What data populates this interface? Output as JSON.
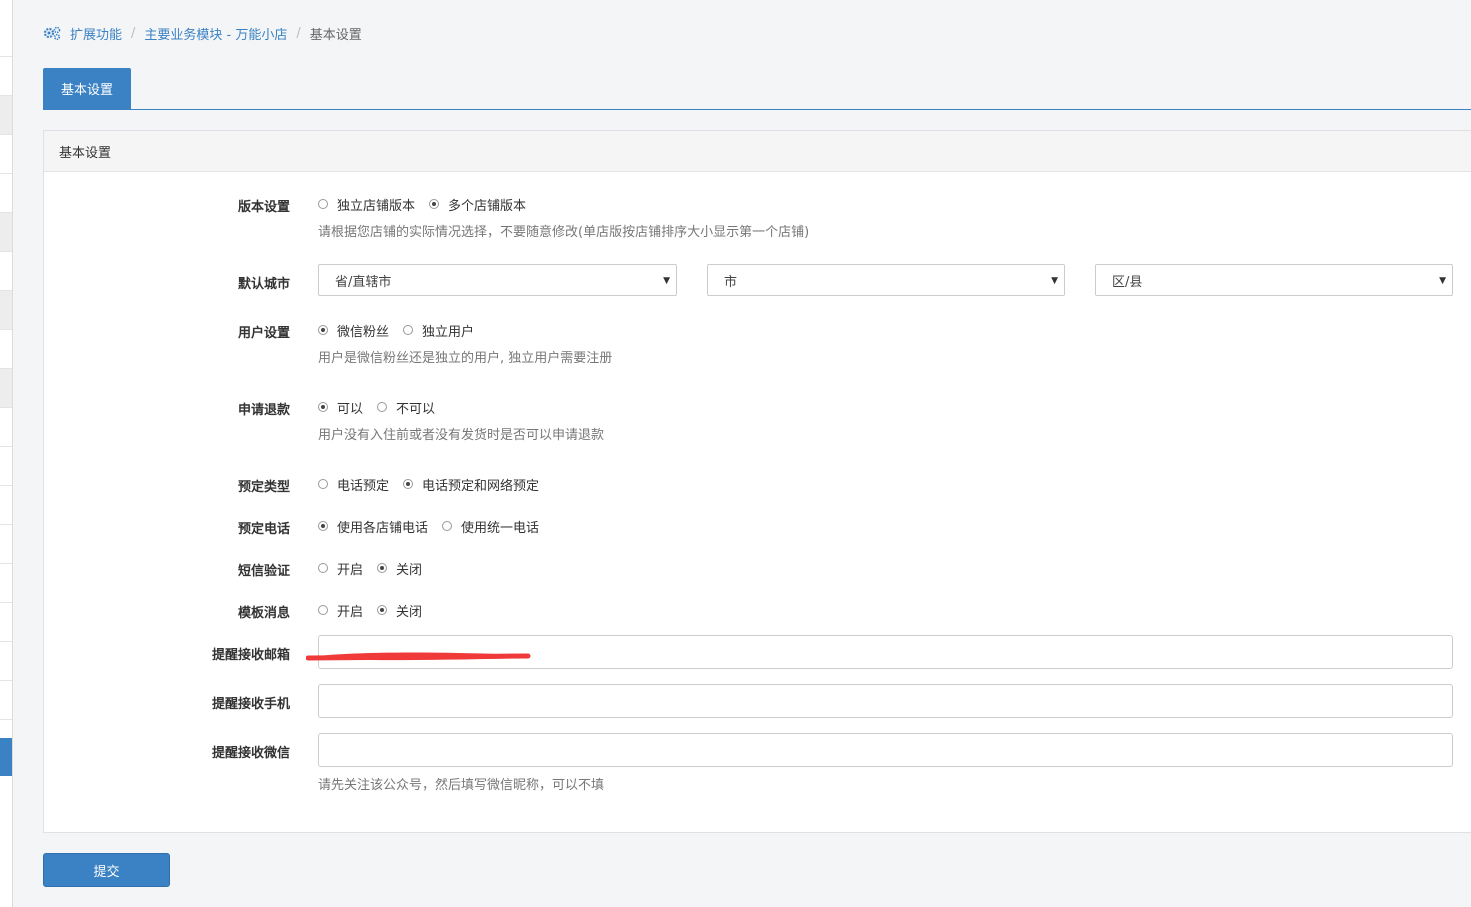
{
  "breadcrumb": {
    "icon": "gears-icon",
    "items": [
      "扩展功能",
      "主要业务模块 - 万能小店"
    ],
    "separator": "/",
    "current": "基本设置"
  },
  "tabs": [
    {
      "label": "基本设置",
      "active": true
    }
  ],
  "panel": {
    "heading": "基本设置"
  },
  "form": {
    "version": {
      "label": "版本设置",
      "options": [
        {
          "label": "独立店铺版本",
          "checked": false
        },
        {
          "label": "多个店铺版本",
          "checked": true
        }
      ],
      "help": "请根据您店铺的实际情况选择，不要随意修改(单店版按店铺排序大小显示第一个店铺)"
    },
    "city": {
      "label": "默认城市",
      "province": "省/直辖市",
      "city": "市",
      "district": "区/县"
    },
    "user": {
      "label": "用户设置",
      "options": [
        {
          "label": "微信粉丝",
          "checked": true
        },
        {
          "label": "独立用户",
          "checked": false
        }
      ],
      "help": "用户是微信粉丝还是独立的用户, 独立用户需要注册"
    },
    "refund": {
      "label": "申请退款",
      "options": [
        {
          "label": "可以",
          "checked": true
        },
        {
          "label": "不可以",
          "checked": false
        }
      ],
      "help": "用户没有入住前或者没有发货时是否可以申请退款"
    },
    "booking_type": {
      "label": "预定类型",
      "options": [
        {
          "label": "电话预定",
          "checked": false
        },
        {
          "label": "电话预定和网络预定",
          "checked": true
        }
      ]
    },
    "booking_phone": {
      "label": "预定电话",
      "options": [
        {
          "label": "使用各店铺电话",
          "checked": true
        },
        {
          "label": "使用统一电话",
          "checked": false
        }
      ]
    },
    "sms": {
      "label": "短信验证",
      "options": [
        {
          "label": "开启",
          "checked": false
        },
        {
          "label": "关闭",
          "checked": true
        }
      ]
    },
    "template": {
      "label": "模板消息",
      "options": [
        {
          "label": "开启",
          "checked": false
        },
        {
          "label": "关闭",
          "checked": true
        }
      ]
    },
    "email": {
      "label": "提醒接收邮箱",
      "value": ""
    },
    "mobile": {
      "label": "提醒接收手机",
      "value": ""
    },
    "wechat": {
      "label": "提醒接收微信",
      "value": "",
      "help": "请先关注该公众号，然后填写微信昵称，可以不填"
    }
  },
  "submit_label": "提交",
  "colors": {
    "primary": "#3b82c4",
    "redaction": "#f03a3a"
  }
}
